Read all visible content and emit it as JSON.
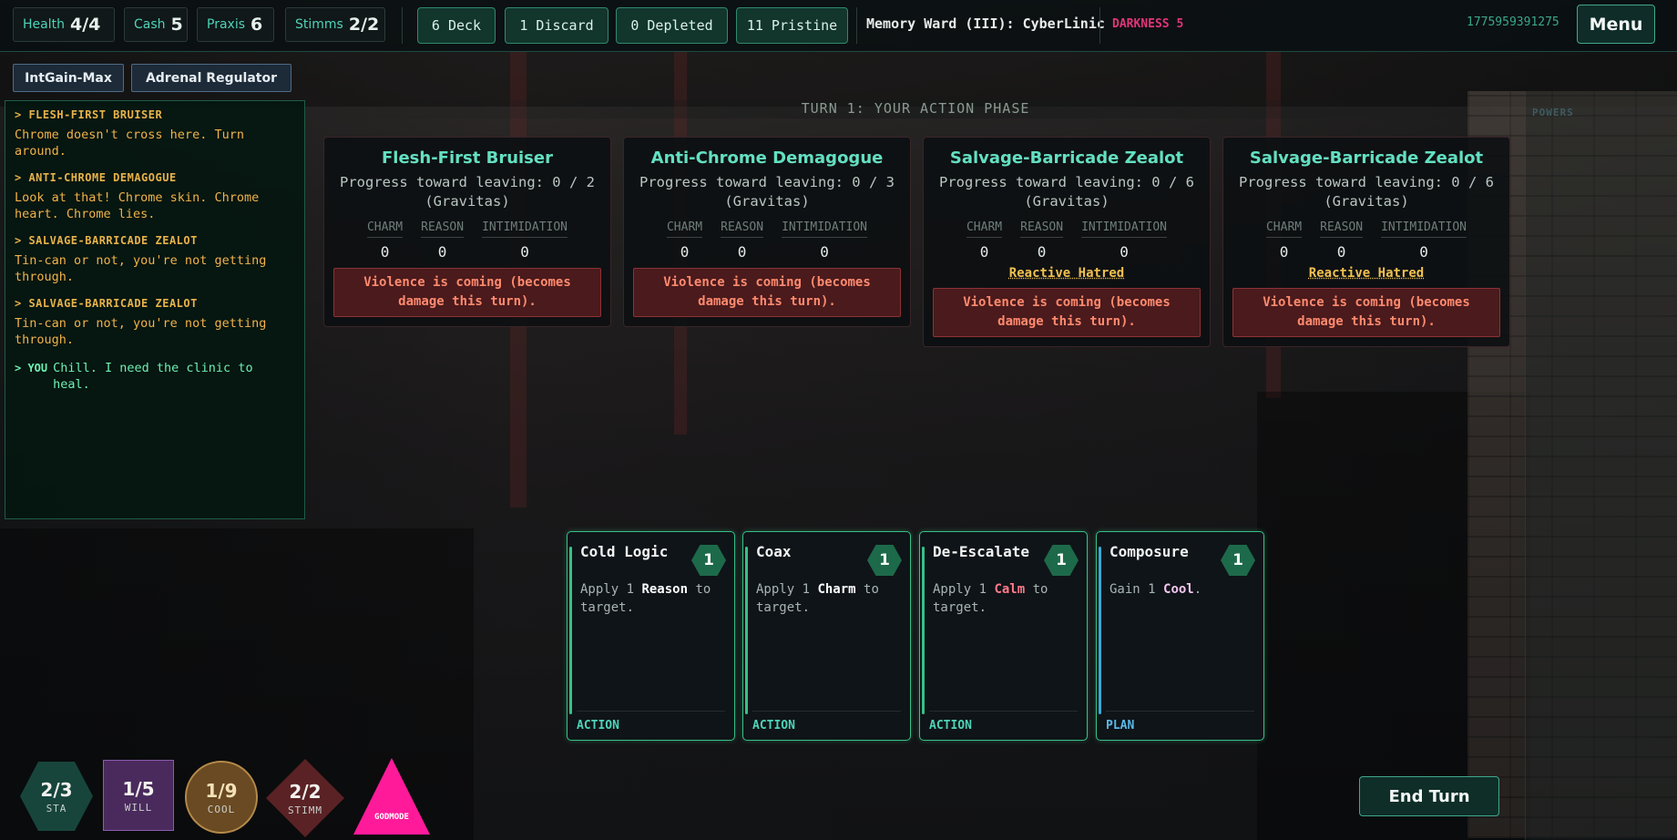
{
  "topbar": {
    "health": {
      "label": "Health",
      "value": "4/4"
    },
    "cash": {
      "label": "Cash",
      "value": "5"
    },
    "praxis": {
      "label": "Praxis",
      "value": "6"
    },
    "stimms": {
      "label": "Stimms",
      "value": "2/2"
    },
    "piles": {
      "deck": "6 Deck",
      "discard": "1 Discard",
      "depleted": "0 Depleted",
      "pristine": "11 Pristine"
    },
    "location": "Memory Ward (III): CyberLinic",
    "darkness": "DARKNESS 5",
    "seed": "1775959391275",
    "menu": "Menu"
  },
  "augments": [
    "IntGain-Max",
    "Adrenal Regulator"
  ],
  "log": [
    {
      "speaker": "> FLESH-FIRST BRUISER",
      "text": "Chrome doesn't cross here. Turn around."
    },
    {
      "speaker": "> ANTI-CHROME DEMAGOGUE",
      "text": "Look at that! Chrome skin. Chrome heart. Chrome lies."
    },
    {
      "speaker": "> SALVAGE-BARRICADE ZEALOT",
      "text": "Tin-can or not, you're not getting through."
    },
    {
      "speaker": "> SALVAGE-BARRICADE ZEALOT",
      "text": "Tin-can or not, you're not getting through."
    }
  ],
  "log_you": {
    "prefix": "> YOU",
    "text": "Chill. I need the clinic to heal."
  },
  "phase": "TURN 1: YOUR ACTION PHASE",
  "powers_label": "POWERS",
  "stat_labels": {
    "charm": "CHARM",
    "reason": "REASON",
    "intimidation": "INTIMIDATION"
  },
  "enemies": [
    {
      "name": "Flesh-First Bruiser",
      "progress": "Progress toward leaving: 0 / 2 (Gravitas)",
      "charm": "0",
      "reason": "0",
      "intimidation": "0",
      "reactive": "",
      "intent": "Violence is coming (becomes damage this turn)."
    },
    {
      "name": "Anti-Chrome Demagogue",
      "progress": "Progress toward leaving: 0 / 3 (Gravitas)",
      "charm": "0",
      "reason": "0",
      "intimidation": "0",
      "reactive": "",
      "intent": "Violence is coming (becomes damage this turn)."
    },
    {
      "name": "Salvage-Barricade Zealot",
      "progress": "Progress toward leaving: 0 / 6 (Gravitas)",
      "charm": "0",
      "reason": "0",
      "intimidation": "0",
      "reactive": "Reactive Hatred",
      "intent": "Violence is coming (becomes damage this turn)."
    },
    {
      "name": "Salvage-Barricade Zealot",
      "progress": "Progress toward leaving: 0 / 6 (Gravitas)",
      "charm": "0",
      "reason": "0",
      "intimidation": "0",
      "reactive": "Reactive Hatred",
      "intent": "Violence is coming (becomes damage this turn)."
    }
  ],
  "hand": [
    {
      "title": "Cold Logic",
      "cost": "1",
      "desc_pre": "Apply 1 ",
      "desc_key": "Reason",
      "desc_post": " to target.",
      "type": "ACTION"
    },
    {
      "title": "Coax",
      "cost": "1",
      "desc_pre": "Apply 1 ",
      "desc_key": "Charm",
      "desc_post": " to target.",
      "type": "ACTION"
    },
    {
      "title": "De-Escalate",
      "cost": "1",
      "desc_pre": "Apply 1 ",
      "desc_key": "Calm",
      "desc_post": " to target.",
      "type": "ACTION"
    },
    {
      "title": "Composure",
      "cost": "1",
      "desc_pre": "Gain 1 ",
      "desc_key": "Cool",
      "desc_post": ".",
      "type": "PLAN"
    }
  ],
  "resources": {
    "sta": {
      "value": "2/3",
      "label": "STA"
    },
    "will": {
      "value": "1/5",
      "label": "WILL"
    },
    "cool": {
      "value": "1/9",
      "label": "COOL"
    },
    "stimm": {
      "value": "2/2",
      "label": "STIMM"
    },
    "godmode": "GODMODE"
  },
  "end_turn": "End Turn",
  "colors": {
    "accent": "#4fd3b8",
    "intent_bg": "#4a1a1c",
    "intent_text": "#ff8a6e",
    "reactive": "#f0c050",
    "darkness": "#e0357a",
    "godmode": "#ff1a9a"
  }
}
